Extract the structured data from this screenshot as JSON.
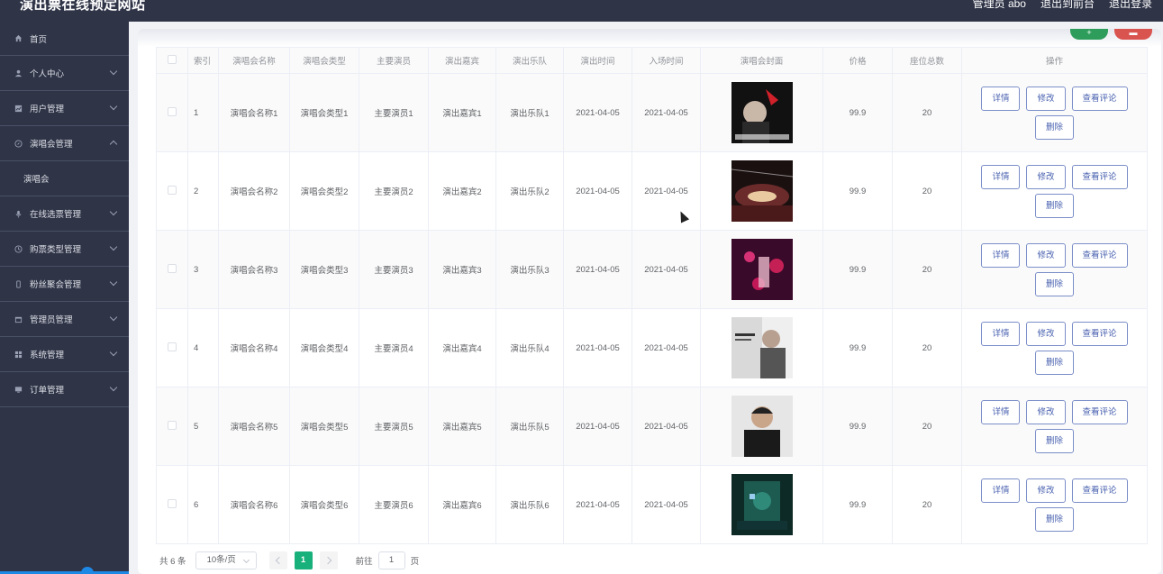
{
  "header": {
    "site_title": "演出票在线预定网站",
    "admin_label": "管理员 abo",
    "exit_front": "退出到前台",
    "logout": "退出登录"
  },
  "sidebar": {
    "items": [
      {
        "label": "首页",
        "icon": "home-icon",
        "expandable": false
      },
      {
        "label": "个人中心",
        "icon": "user-icon",
        "expandable": true
      },
      {
        "label": "用户管理",
        "icon": "chart-icon",
        "expandable": true
      },
      {
        "label": "演唱会管理",
        "icon": "compass-icon",
        "expandable": true,
        "expanded": true
      },
      {
        "label": "演唱会",
        "icon": "",
        "expandable": false,
        "sub": true
      },
      {
        "label": "在线选票管理",
        "icon": "mic-icon",
        "expandable": true
      },
      {
        "label": "购票类型管理",
        "icon": "clock-icon",
        "expandable": true
      },
      {
        "label": "粉丝聚会管理",
        "icon": "phone-icon",
        "expandable": true
      },
      {
        "label": "管理员管理",
        "icon": "calendar-icon",
        "expandable": true
      },
      {
        "label": "系统管理",
        "icon": "grid-icon",
        "expandable": true
      },
      {
        "label": "订单管理",
        "icon": "monitor-icon",
        "expandable": true
      }
    ]
  },
  "table": {
    "headers": [
      "索引",
      "演唱会名称",
      "演唱会类型",
      "主要演员",
      "演出嘉宾",
      "演出乐队",
      "演出时间",
      "入场时间",
      "演唱会封面",
      "价格",
      "座位总数",
      "操作"
    ],
    "rows": [
      {
        "index": "1",
        "name": "演唱会名称1",
        "type": "演唱会类型1",
        "actor": "主要演员1",
        "guest": "演出嘉宾1",
        "band": "演出乐队1",
        "show_time": "2021-04-05",
        "entry_time": "2021-04-05",
        "price": "99.9",
        "seats": "20"
      },
      {
        "index": "2",
        "name": "演唱会名称2",
        "type": "演唱会类型2",
        "actor": "主要演员2",
        "guest": "演出嘉宾2",
        "band": "演出乐队2",
        "show_time": "2021-04-05",
        "entry_time": "2021-04-05",
        "price": "99.9",
        "seats": "20"
      },
      {
        "index": "3",
        "name": "演唱会名称3",
        "type": "演唱会类型3",
        "actor": "主要演员3",
        "guest": "演出嘉宾3",
        "band": "演出乐队3",
        "show_time": "2021-04-05",
        "entry_time": "2021-04-05",
        "price": "99.9",
        "seats": "20"
      },
      {
        "index": "4",
        "name": "演唱会名称4",
        "type": "演唱会类型4",
        "actor": "主要演员4",
        "guest": "演出嘉宾4",
        "band": "演出乐队4",
        "show_time": "2021-04-05",
        "entry_time": "2021-04-05",
        "price": "99.9",
        "seats": "20"
      },
      {
        "index": "5",
        "name": "演唱会名称5",
        "type": "演唱会类型5",
        "actor": "主要演员5",
        "guest": "演出嘉宾5",
        "band": "演出乐队5",
        "show_time": "2021-04-05",
        "entry_time": "2021-04-05",
        "price": "99.9",
        "seats": "20"
      },
      {
        "index": "6",
        "name": "演唱会名称6",
        "type": "演唱会类型6",
        "actor": "主要演员6",
        "guest": "演出嘉宾6",
        "band": "演出乐队6",
        "show_time": "2021-04-05",
        "entry_time": "2021-04-05",
        "price": "99.9",
        "seats": "20"
      }
    ],
    "actions": {
      "detail": "详情",
      "edit": "修改",
      "comments": "查看评论",
      "delete": "删除"
    }
  },
  "pagination": {
    "total": "共 6 条",
    "page_size": "10条/页",
    "current_page": "1",
    "goto_label": "前往",
    "goto_value": "1",
    "page_suffix": "页"
  },
  "colors": {
    "sidebar_bg": "#2f3447",
    "accent_green": "#18b07b",
    "action_border": "#7b8ec8"
  }
}
